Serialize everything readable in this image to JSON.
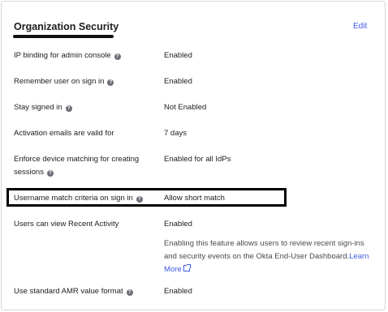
{
  "section": {
    "title": "Organization Security",
    "edit_label": "Edit"
  },
  "rows": [
    {
      "label": "IP binding for admin console",
      "value": "Enabled"
    },
    {
      "label": "Remember user on sign in",
      "value": "Enabled"
    },
    {
      "label": "Stay signed in",
      "value": "Not Enabled"
    },
    {
      "label": "Activation emails are valid for",
      "value": "7 days"
    },
    {
      "label": "Enforce device matching for creating sessions",
      "value": "Enabled for all IdPs"
    },
    {
      "label": "Username match criteria on sign in",
      "value": "Allow short match"
    },
    {
      "label": "Users can view Recent Activity",
      "value": "Enabled",
      "description": "Enabling this feature allows users to review recent sign-ins and security events on the Okta End-User Dashboard.",
      "link": "Learn More"
    },
    {
      "label": "Use standard AMR value format",
      "value": "Enabled"
    }
  ]
}
